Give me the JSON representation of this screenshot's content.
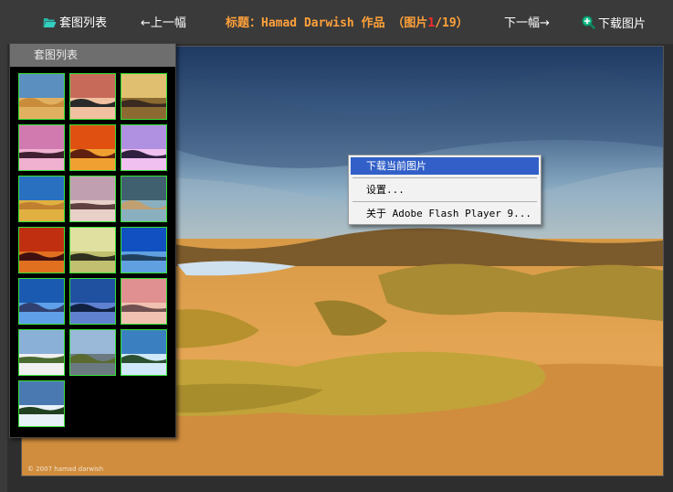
{
  "toolbar": {
    "set_list_label": "套图列表",
    "prev_label": "←上一幅",
    "title_prefix": "标题：Hamad Darwish 作品 （图片",
    "current_index": "1",
    "title_suffix": "/19）",
    "next_label": "下一幅→",
    "download_label": "下载图片"
  },
  "panel": {
    "header": "套图列表",
    "thumbnail_count": 19
  },
  "context_menu": {
    "items": [
      "下载当前图片",
      "设置...",
      "关于 Adobe Flash Player 9..."
    ],
    "selected_index": 0
  },
  "photo": {
    "watermark": "© 2007 hamad darwish"
  },
  "colors": {
    "title": "#ffa13a",
    "current_index": "#ff2a2a",
    "thumb_border": "#35e035",
    "menu_highlight": "#3260c8"
  }
}
